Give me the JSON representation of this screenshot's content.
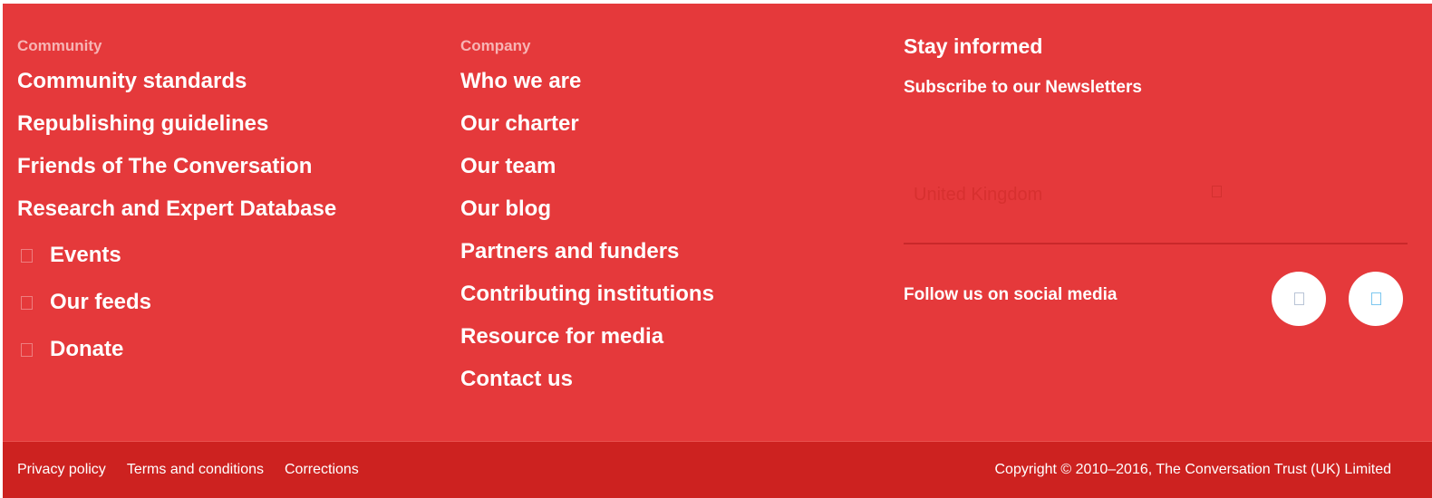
{
  "community": {
    "heading": "Community",
    "links": [
      "Community standards",
      "Republishing guidelines",
      "Friends of The Conversation",
      "Research and Expert Database"
    ],
    "icon_links": [
      {
        "icon": "events-icon",
        "label": "Events"
      },
      {
        "icon": "feeds-icon",
        "label": "Our feeds"
      },
      {
        "icon": "donate-icon",
        "label": "Donate"
      }
    ]
  },
  "company": {
    "heading": "Company",
    "links": [
      "Who we are",
      "Our charter",
      "Our team",
      "Our blog",
      "Partners and funders",
      "Contributing institutions",
      "Resource for media",
      "Contact us"
    ]
  },
  "stay_informed": {
    "title": "Stay informed",
    "subscribe_label": "Subscribe to our Newsletters",
    "edition_select": {
      "value": "United Kingdom",
      "icon": "chevron-down-icon"
    },
    "social_label": "Follow us on social media",
    "social": [
      {
        "icon": "facebook-icon",
        "color": "#3b5998"
      },
      {
        "icon": "twitter-icon",
        "color": "#1da1f2"
      }
    ]
  },
  "bottom": {
    "links": [
      "Privacy policy",
      "Terms and conditions",
      "Corrections"
    ],
    "copyright": "Copyright © 2010–2016, The Conversation Trust (UK) Limited"
  },
  "colors": {
    "footer_bg": "#e5393b",
    "bar_bg": "#cd2220",
    "heading": "#f7b4b4",
    "text": "#ffffff"
  }
}
